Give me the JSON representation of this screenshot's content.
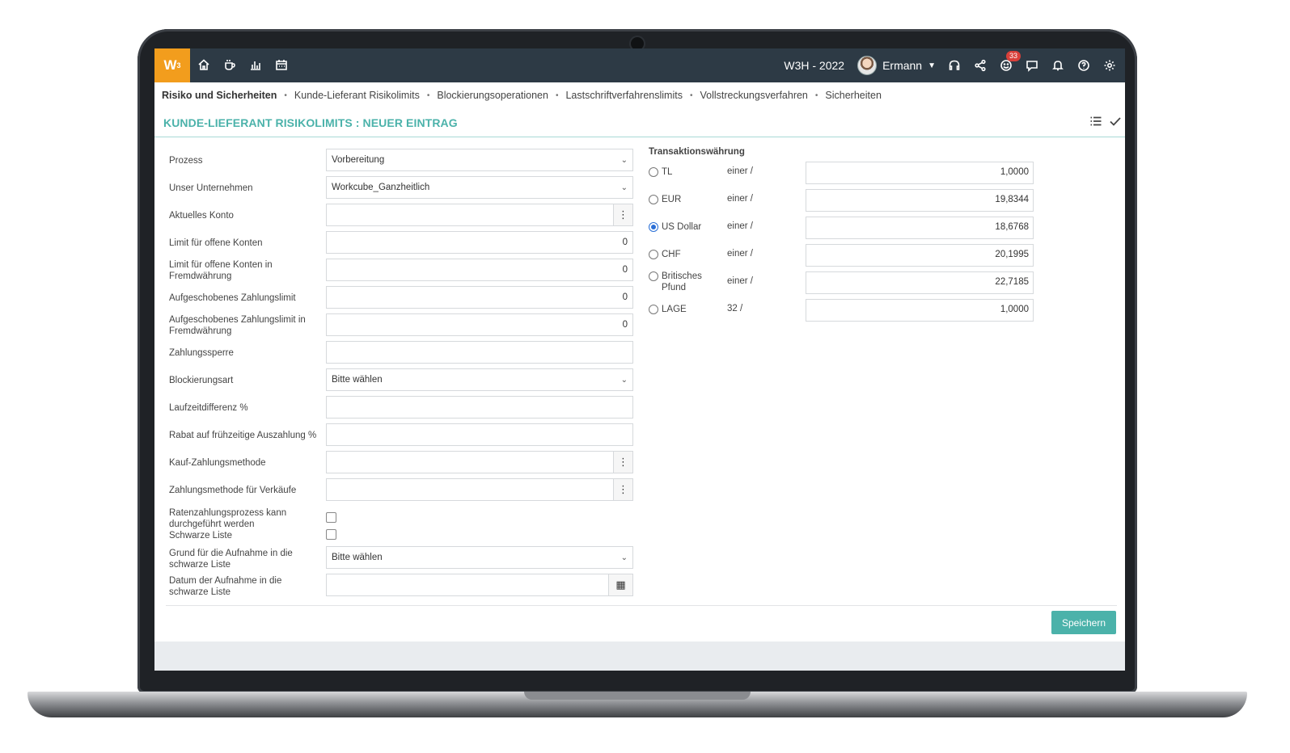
{
  "topbar": {
    "logo": "W",
    "logo_sup": "3",
    "period": "W3H - 2022",
    "user_name": "Ermann",
    "notification_count": "33",
    "icons": [
      "home-icon",
      "coffee-icon",
      "chart-icon",
      "calendar-icon",
      "headset-icon",
      "share-icon",
      "smiley-icon",
      "chat-icon",
      "bell-icon",
      "help-icon",
      "gear-icon"
    ]
  },
  "breadcrumbs": [
    "Risiko und Sicherheiten",
    "Kunde-Lieferant Risikolimits",
    "Blockierungsoperationen",
    "Lastschriftverfahrenslimits",
    "Vollstreckungsverfahren",
    "Sicherheiten"
  ],
  "page": {
    "title": "KUNDE-LIEFERANT RISIKOLIMITS : NEUER EINTRAG",
    "save_label": "Speichern"
  },
  "form": {
    "process": {
      "label": "Prozess",
      "value": "Vorbereitung"
    },
    "company": {
      "label": "Unser Unternehmen",
      "value": "Workcube_Ganzheitlich"
    },
    "account": {
      "label": "Aktuelles Konto",
      "value": ""
    },
    "open_limit": {
      "label": "Limit für offene Konten",
      "value": "0"
    },
    "open_limit_fx": {
      "label": "Limit für offene Konten in Fremdwährung",
      "value": "0"
    },
    "deferred_limit": {
      "label": "Aufgeschobenes Zahlungslimit",
      "value": "0"
    },
    "deferred_limit_fx": {
      "label": "Aufgeschobenes Zahlungslimit in Fremdwährung",
      "value": "0"
    },
    "payment_block": {
      "label": "Zahlungssperre",
      "value": ""
    },
    "block_type": {
      "label": "Blockierungsart",
      "value": "Bitte wählen"
    },
    "term_diff": {
      "label": "Laufzeitdifferenz %",
      "value": ""
    },
    "early_discount": {
      "label": "Rabat auf frühzeitige Auszahlung %",
      "value": ""
    },
    "purchase_method": {
      "label": "Kauf-Zahlungsmethode",
      "value": ""
    },
    "sales_method": {
      "label": "Zahlungsmethode für Verkäufe",
      "value": ""
    },
    "installment": {
      "label": "Ratenzahlungsprozess kann durchgeführt werden",
      "checked": false
    },
    "blacklist": {
      "label": "Schwarze Liste",
      "checked": false
    },
    "blacklist_reason": {
      "label": "Grund für die Aufnahme in die schwarze Liste",
      "value": "Bitte wählen"
    },
    "blacklist_date": {
      "label": "Datum der Aufnahme in die schwarze Liste",
      "value": ""
    }
  },
  "currency": {
    "title": "Transaktionswährung",
    "rows": [
      {
        "name": "TL",
        "unit": "einer /",
        "rate": "1,0000",
        "selected": false
      },
      {
        "name": "EUR",
        "unit": "einer /",
        "rate": "19,8344",
        "selected": false
      },
      {
        "name": "US Dollar",
        "unit": "einer /",
        "rate": "18,6768",
        "selected": true
      },
      {
        "name": "CHF",
        "unit": "einer /",
        "rate": "20,1995",
        "selected": false
      },
      {
        "name": "Britisches Pfund",
        "unit": "einer /",
        "rate": "22,7185",
        "selected": false
      },
      {
        "name": "LAGE",
        "unit": "32 /",
        "rate": "1,0000",
        "selected": false
      }
    ]
  }
}
